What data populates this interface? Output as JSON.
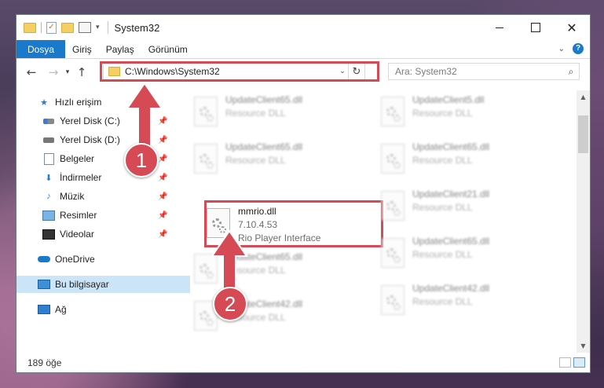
{
  "window": {
    "title": "System32",
    "controls": {
      "minimize": "minimize-icon",
      "maximize": "maximize-icon",
      "close": "close-icon"
    }
  },
  "ribbon": {
    "tabs": [
      "Dosya",
      "Giriş",
      "Paylaş",
      "Görünüm"
    ]
  },
  "navigation": {
    "address": "C:\\Windows\\System32",
    "search_placeholder": "Ara: System32"
  },
  "sidebar": {
    "items": [
      {
        "label": "Hızlı erişim",
        "icon": "star-icon"
      },
      {
        "label": "Yerel Disk (C:)",
        "icon": "drive-icon",
        "pinned": true
      },
      {
        "label": "Yerel Disk (D:)",
        "icon": "drive-icon",
        "pinned": true
      },
      {
        "label": "Belgeler",
        "icon": "documents-icon",
        "pinned": true
      },
      {
        "label": "İndirmeler",
        "icon": "download-icon",
        "pinned": true
      },
      {
        "label": "Müzik",
        "icon": "music-icon",
        "pinned": true
      },
      {
        "label": "Resimler",
        "icon": "pictures-icon",
        "pinned": true
      },
      {
        "label": "Videolar",
        "icon": "videos-icon",
        "pinned": true
      },
      {
        "label": "OneDrive",
        "icon": "cloud-icon"
      },
      {
        "label": "Bu bilgisayar",
        "icon": "computer-icon",
        "selected": true
      },
      {
        "label": "Ağ",
        "icon": "network-icon"
      }
    ]
  },
  "files": {
    "left": [
      {
        "name": "UpdateClient65.dll",
        "desc": "Resource DLL"
      },
      {
        "name": "UpdateClient65.dll",
        "desc": "Resource DLL"
      },
      {
        "name": "mmrio.dll",
        "version": "7.10.4.53",
        "desc": "Rio Player Interface"
      },
      {
        "name": "UpdateClient65.dll",
        "desc": "Resource DLL"
      },
      {
        "name": "UpdateClient42.dll",
        "desc": "Resource DLL"
      }
    ],
    "right": [
      {
        "name": "UpdateClient5.dll",
        "desc": "Resource DLL"
      },
      {
        "name": "UpdateClient65.dll",
        "desc": "Resource DLL"
      },
      {
        "name": "UpdateClient21.dll",
        "desc": "Resource DLL"
      },
      {
        "name": "UpdateClient65.dll",
        "desc": "Resource DLL"
      },
      {
        "name": "UpdateClient42.dll",
        "desc": "Resource DLL"
      }
    ]
  },
  "status": {
    "item_count": "189 öğe"
  },
  "annotations": {
    "step1": "1",
    "step2": "2",
    "highlight_color": "#d64a55"
  }
}
